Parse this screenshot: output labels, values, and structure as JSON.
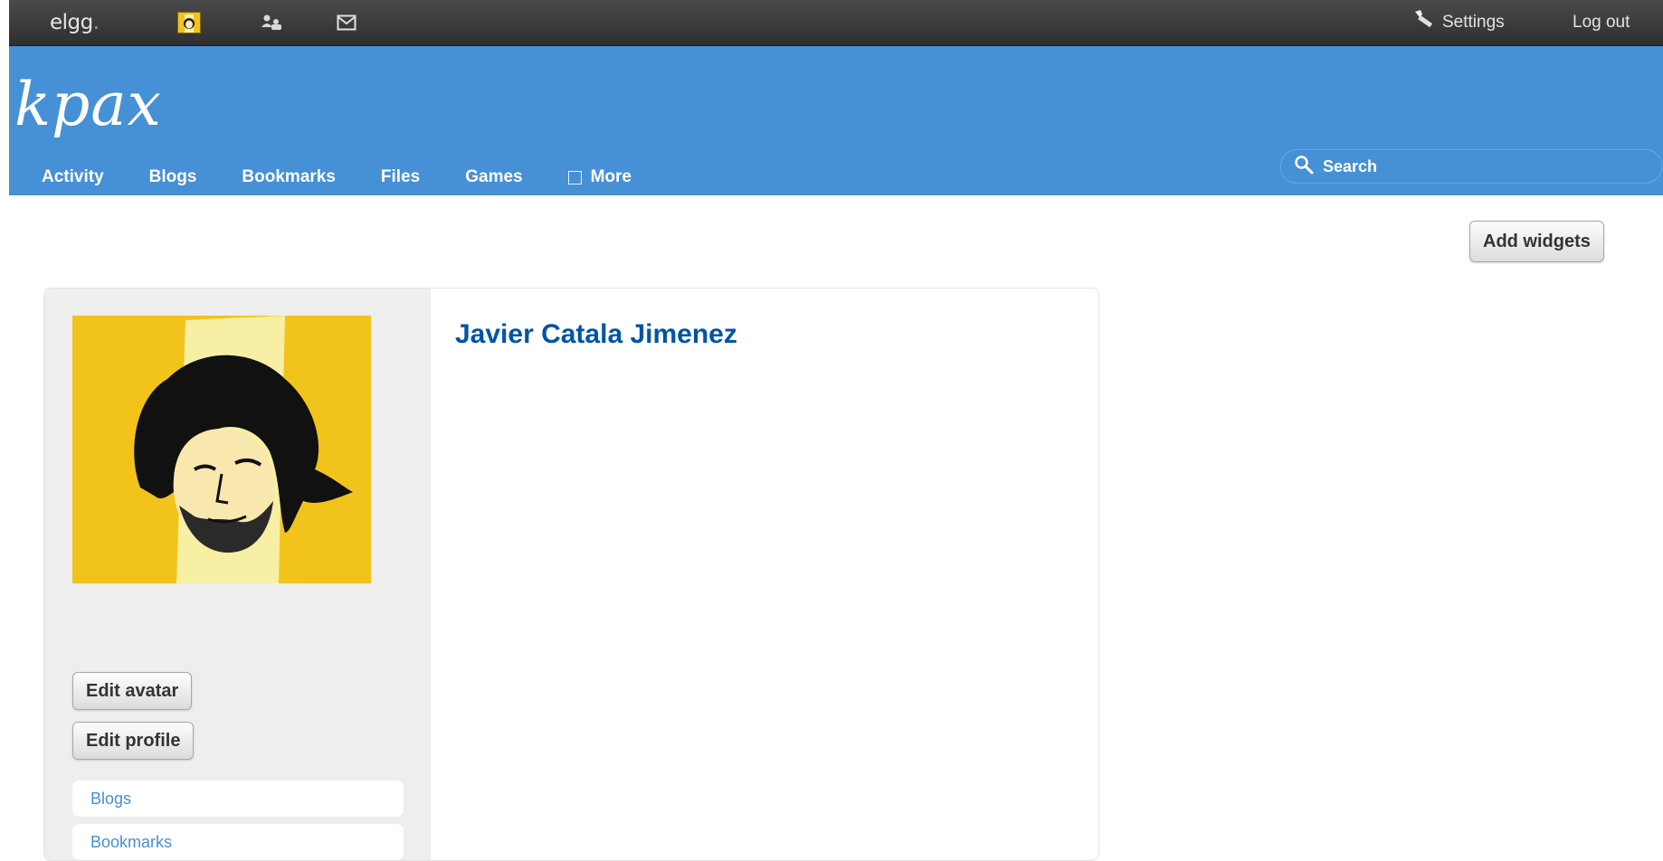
{
  "topbar": {
    "logo_text": "elgg",
    "logo_dot": ".",
    "settings_label": "Settings",
    "logout_label": "Log out"
  },
  "header": {
    "site_name": "kpax",
    "nav": [
      "Activity",
      "Blogs",
      "Bookmarks",
      "Files",
      "Games",
      "More"
    ],
    "search_placeholder": "Search"
  },
  "actions": {
    "add_widgets": "Add widgets"
  },
  "profile": {
    "name": "Javier Catala Jimenez",
    "edit_avatar": "Edit avatar",
    "edit_profile": "Edit profile",
    "links": [
      "Blogs",
      "Bookmarks"
    ]
  },
  "colors": {
    "header_blue": "#4690d6",
    "name_blue": "#0054a7",
    "avatar_yellow": "#f2c31a",
    "toolbar_dark": "#333333"
  },
  "icons": {
    "settings": "wrench-icon",
    "search": "magnifier-icon",
    "friends": "friends-icon",
    "messages": "envelope-icon"
  }
}
